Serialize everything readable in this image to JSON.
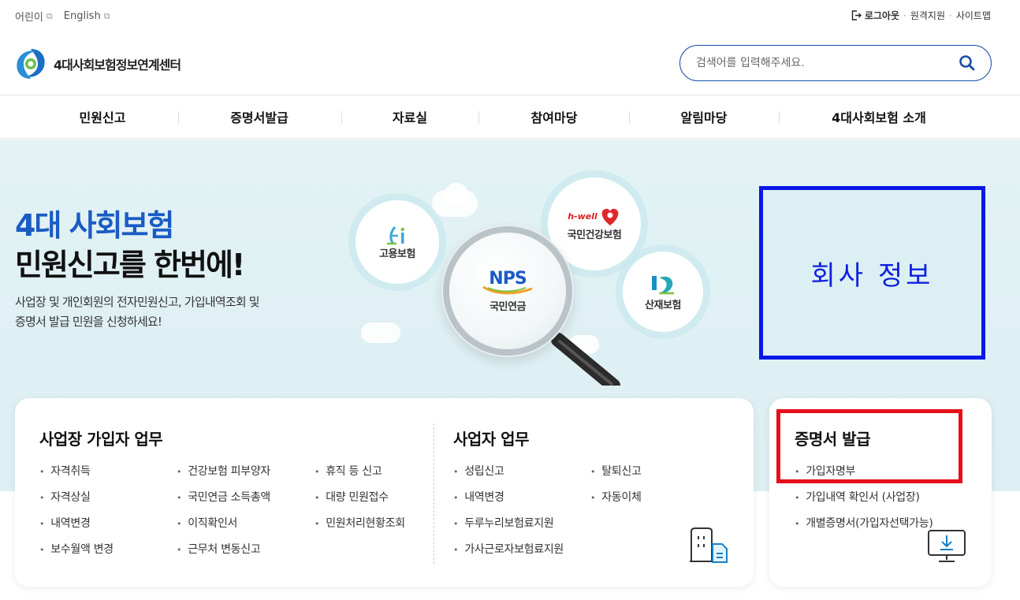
{
  "util": {
    "links": [
      {
        "label": "어린이"
      },
      {
        "label": "English"
      }
    ],
    "logout": "로그아웃",
    "remote": "원격지원",
    "sitemap": "사이트맵",
    "separator": "·"
  },
  "logo": {
    "text": "4대사회보험정보연계센터"
  },
  "search": {
    "placeholder": "검색어를 입력해주세요."
  },
  "gnb": [
    "민원신고",
    "증명서발급",
    "자료실",
    "참여마당",
    "알림마당",
    "4대사회보험 소개"
  ],
  "hero": {
    "title_line1": "4대 사회보험",
    "title_line2": "민원신고를 한번에!",
    "desc_line1": "사업장 및 개인회원의 전자민원신고, 가입내역조회 및",
    "desc_line2": "증명서 발급 민원을 신청하세요!",
    "bubbles": {
      "employment": "고용보험",
      "health": "국민건강보험",
      "health_brand": "h-well",
      "pension": "국민연금",
      "pension_brand": "NPS",
      "industrial": "산재보험"
    }
  },
  "company_box": "회사 정보",
  "workplace": {
    "title": "사업장 가입자 업무",
    "col1": [
      "자격취득",
      "자격상실",
      "내역변경",
      "보수월액 변경"
    ],
    "col2": [
      "건강보험 피부양자",
      "국민연금 소득총액",
      "이직확인서",
      "근무처 변동신고"
    ],
    "col3": [
      "휴직 등 신고",
      "대량 민원접수",
      "민원처리현황조회"
    ]
  },
  "business": {
    "title": "사업자 업무",
    "col1": [
      "성립신고",
      "내역변경",
      "두루누리보험료지원",
      "가사근로자보험료지원"
    ],
    "col2": [
      "탈퇴신고",
      "자동이체"
    ]
  },
  "certificate": {
    "title": "증명서 발급",
    "items": [
      "가입자명부",
      "가입내역 확인서 (사업장)",
      "개별증명서(가입자선택가능)"
    ]
  },
  "colors": {
    "brand_blue": "#1a5bc4",
    "highlight_blue": "#0a17e6",
    "highlight_red": "#e60f1a"
  }
}
